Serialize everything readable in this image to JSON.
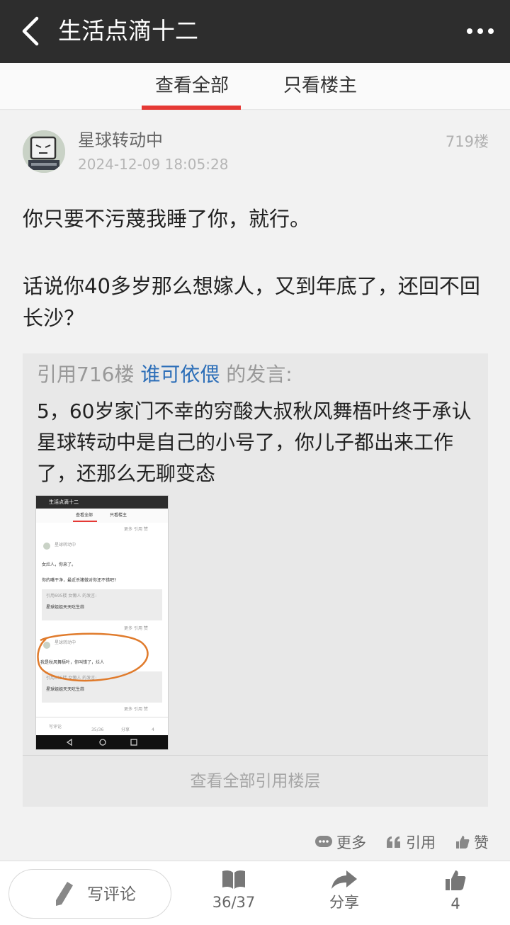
{
  "topbar": {
    "title": "生活点滴十二",
    "back_icon": "chevron-left-icon",
    "more_icon": "more-dots-icon"
  },
  "tabs": [
    {
      "label": "查看全部",
      "active": true
    },
    {
      "label": "只看楼主",
      "active": false
    }
  ],
  "post": {
    "author": "星球转动中",
    "time": "2024-12-09 18:05:28",
    "floor": "719楼",
    "paragraph1": "你只要不污蔑我睡了你，就行。",
    "paragraph2": "话说你40多岁那么想嫁人，又到年底了，还回不回长沙？",
    "quote": {
      "prefix": "引用716楼",
      "user": "谁可依偎",
      "suffix": "的发言:",
      "text": "5，60岁家门不幸的穷酸大叔秋风舞梧叶终于承认星球转动中是自己的小号了，你儿子都出来工作了，还那么无聊变态",
      "view_all": "查看全部引用楼层"
    },
    "actions": {
      "more": "更多",
      "quote": "引用",
      "like": "赞"
    }
  },
  "thumbnail": {
    "title": "生活点滴十二",
    "tab_all": "查看全部",
    "tab_owner": "只看楼主",
    "author": "星球转动中",
    "msg1": "女烂人，你来了。",
    "msg2": "你的嘴干净，最近杀猪做对你还不错吧?",
    "quote1": "引用695楼 女懒人 的发言:",
    "quote1_text": "星球姐姐天天吃生蒜",
    "msg3": "我是秋风舞梧叶，你叫错了，烂人",
    "quote2": "引用695楼 女懒人 的发言:",
    "quote2_text": "星球姐姐天天吃生蒜",
    "more": "更多",
    "cite": "引用",
    "like": "赞",
    "comment": "写评论",
    "pages": "35/36",
    "share": "分享",
    "likes": "4",
    "highlight_color": "#e07b2c"
  },
  "bottombar": {
    "comment": "写评论",
    "pages": "36/37",
    "share": "分享",
    "likes": "4"
  },
  "colors": {
    "topbar": "#2d2d2d",
    "accent": "#e53935",
    "link": "#2c6eb8"
  }
}
